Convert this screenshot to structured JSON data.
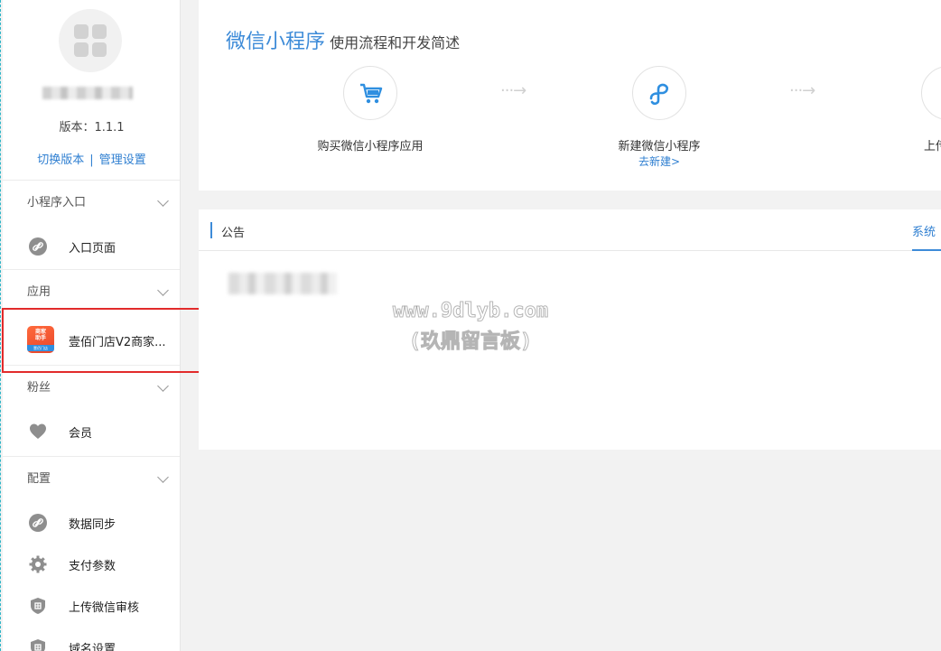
{
  "sidebar": {
    "version": "版本：1.1.1",
    "switch_version": "切换版本",
    "separator": "|",
    "manage_settings": "管理设置",
    "sections": [
      {
        "title": "小程序入口",
        "items": [
          {
            "label": "入口页面",
            "icon": "link-icon"
          }
        ]
      },
      {
        "title": "应用",
        "items": [
          {
            "label": "壹佰门店V2商家...",
            "icon": "app-icon"
          }
        ]
      },
      {
        "title": "粉丝",
        "items": [
          {
            "label": "会员",
            "icon": "heart-icon"
          }
        ]
      },
      {
        "title": "配置",
        "items": [
          {
            "label": "数据同步",
            "icon": "link-icon"
          },
          {
            "label": "支付参数",
            "icon": "gear-icon"
          },
          {
            "label": "上传微信审核",
            "icon": "shield-icon"
          },
          {
            "label": "域名设置",
            "icon": "shield-icon"
          }
        ]
      }
    ],
    "app_icon_text": {
      "line1": "商家",
      "line2": "助手",
      "line3": "壹佰门店"
    }
  },
  "main": {
    "title_big": "微信小程序",
    "title_small": "使用流程和开发简述",
    "steps": [
      {
        "title": "购买微信小程序应用",
        "icon": "cart-icon"
      },
      {
        "title": "新建微信小程序",
        "link": "去新建>",
        "icon": "mini-program-icon"
      },
      {
        "title": "上传"
      }
    ],
    "arrow": "···→",
    "notice": {
      "title": "公告",
      "tab": "系统"
    }
  },
  "watermark": {
    "line1": "www.9dlyb.com",
    "line2": "(玖鼎留言板)"
  },
  "colors": {
    "accent": "#3d8bd8",
    "highlight": "#e22b2b"
  }
}
